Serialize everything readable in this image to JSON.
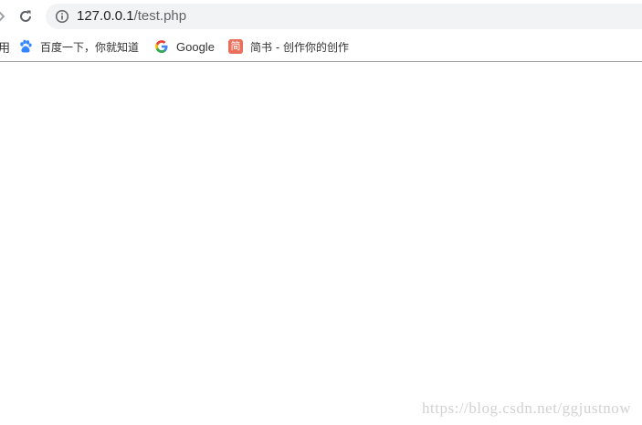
{
  "address_bar": {
    "host": "127.0.0.1",
    "path": "/test.php"
  },
  "bookmarks": {
    "edge_fragment": "用",
    "items": [
      {
        "label": "百度一下，你就知道",
        "icon": "baidu-paw-icon"
      },
      {
        "label": "Google",
        "icon": "google-g-icon"
      },
      {
        "label": "简书 - 创作你的创作",
        "icon": "jianshu-icon",
        "icon_text": "简"
      }
    ]
  },
  "watermark": "https://blog.csdn.net/ggjustnow",
  "colors": {
    "omnibox_bg": "#f1f3f4",
    "jianshu_brand": "#ea6f5a",
    "baidu_blue": "#3385ff"
  }
}
